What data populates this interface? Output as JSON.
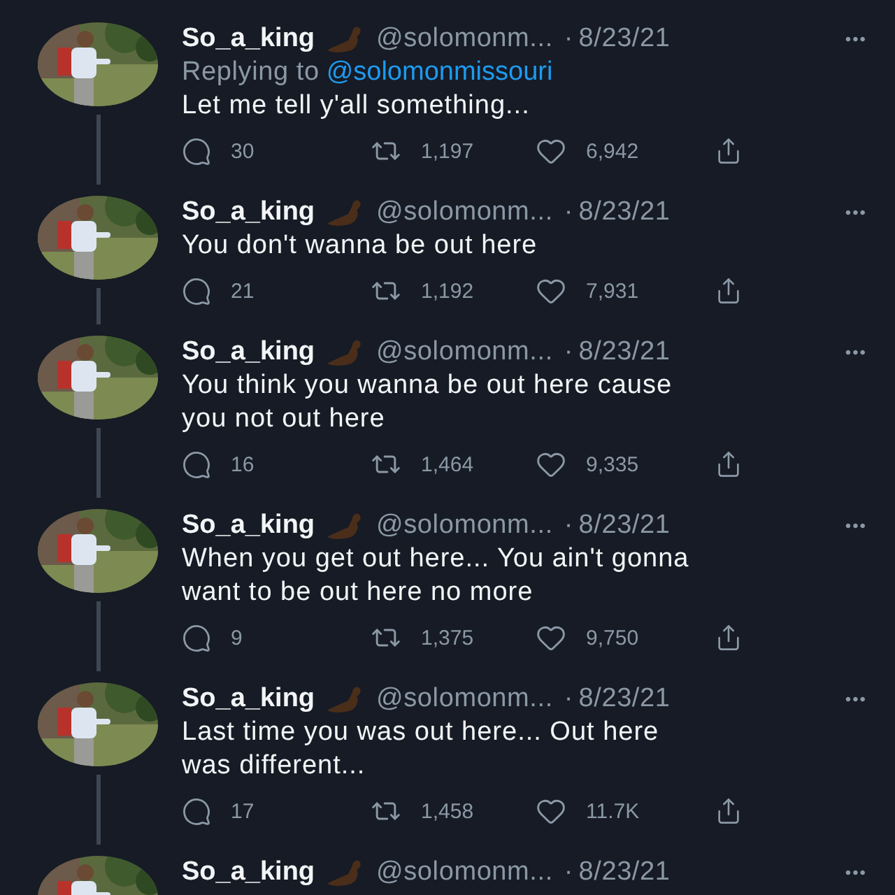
{
  "tweets": [
    {
      "name": "So_a_king",
      "handle": "@solomonm...",
      "dot": "·",
      "date": "8/23/21",
      "more": "•••",
      "replying_label": "Replying to",
      "replying_to": "@solomonmissouri",
      "text": [
        "Let me tell y'all something..."
      ],
      "stats": {
        "replies": "30",
        "retweets": "1,197",
        "likes": "6,942"
      }
    },
    {
      "name": "So_a_king",
      "handle": "@solomonm...",
      "dot": "·",
      "date": "8/23/21",
      "more": "•••",
      "text": [
        "You don't wanna be out here"
      ],
      "stats": {
        "replies": "21",
        "retweets": "1,192",
        "likes": "7,931"
      }
    },
    {
      "name": "So_a_king",
      "handle": "@solomonm...",
      "dot": "·",
      "date": "8/23/21",
      "more": "•••",
      "text": [
        "You think you wanna be out here cause",
        "you not out here"
      ],
      "stats": {
        "replies": "16",
        "retweets": "1,464",
        "likes": "9,335"
      }
    },
    {
      "name": "So_a_king",
      "handle": "@solomonm...",
      "dot": "·",
      "date": "8/23/21",
      "more": "•••",
      "text": [
        "When you get out here... You ain't gonna",
        "want to be out here no more"
      ],
      "stats": {
        "replies": "9",
        "retweets": "1,375",
        "likes": "9,750"
      }
    },
    {
      "name": "So_a_king",
      "handle": "@solomonm...",
      "dot": "·",
      "date": "8/23/21",
      "more": "•••",
      "text": [
        "Last time you was out here... Out here",
        "was different..."
      ],
      "stats": {
        "replies": "17",
        "retweets": "1,458",
        "likes": "11.7K"
      }
    },
    {
      "name": "So_a_king",
      "handle": "@solomonm...",
      "dot": "·",
      "date": "8/23/21",
      "more": "•••"
    }
  ]
}
